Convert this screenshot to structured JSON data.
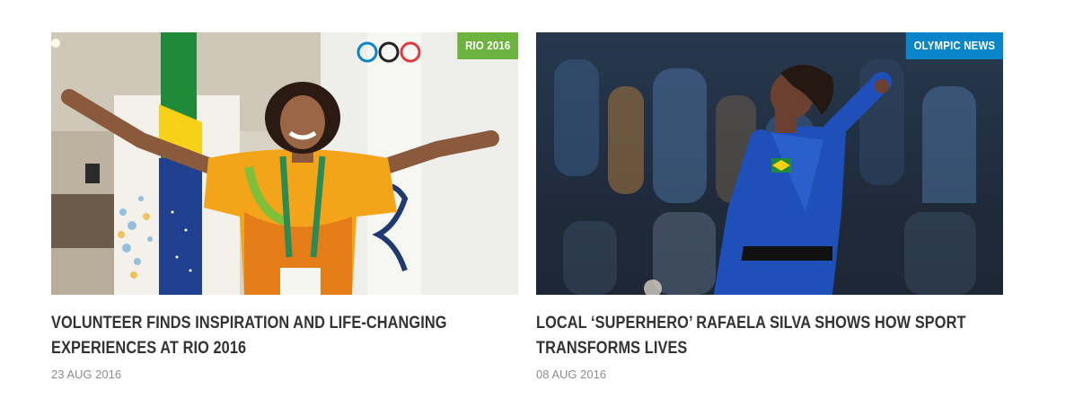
{
  "articles": [
    {
      "badge": "RIO 2016",
      "badge_color": "#6cb33f",
      "title": "VOLUNTEER FINDS INSPIRATION AND LIFE-CHANGING EXPERIENCES AT RIO 2016",
      "date": "23 AUG 2016",
      "image": "volunteer-photo"
    },
    {
      "badge": "OLYMPIC NEWS",
      "badge_color": "#0a85c9",
      "title": "LOCAL ‘SUPERHERO’ RAFAELA SILVA SHOWS HOW SPORT TRANSFORMS LIVES",
      "date": "08 AUG 2016",
      "image": "judoka-photo"
    }
  ],
  "colors": {
    "title": "#333333",
    "date": "#8c8c8c"
  }
}
